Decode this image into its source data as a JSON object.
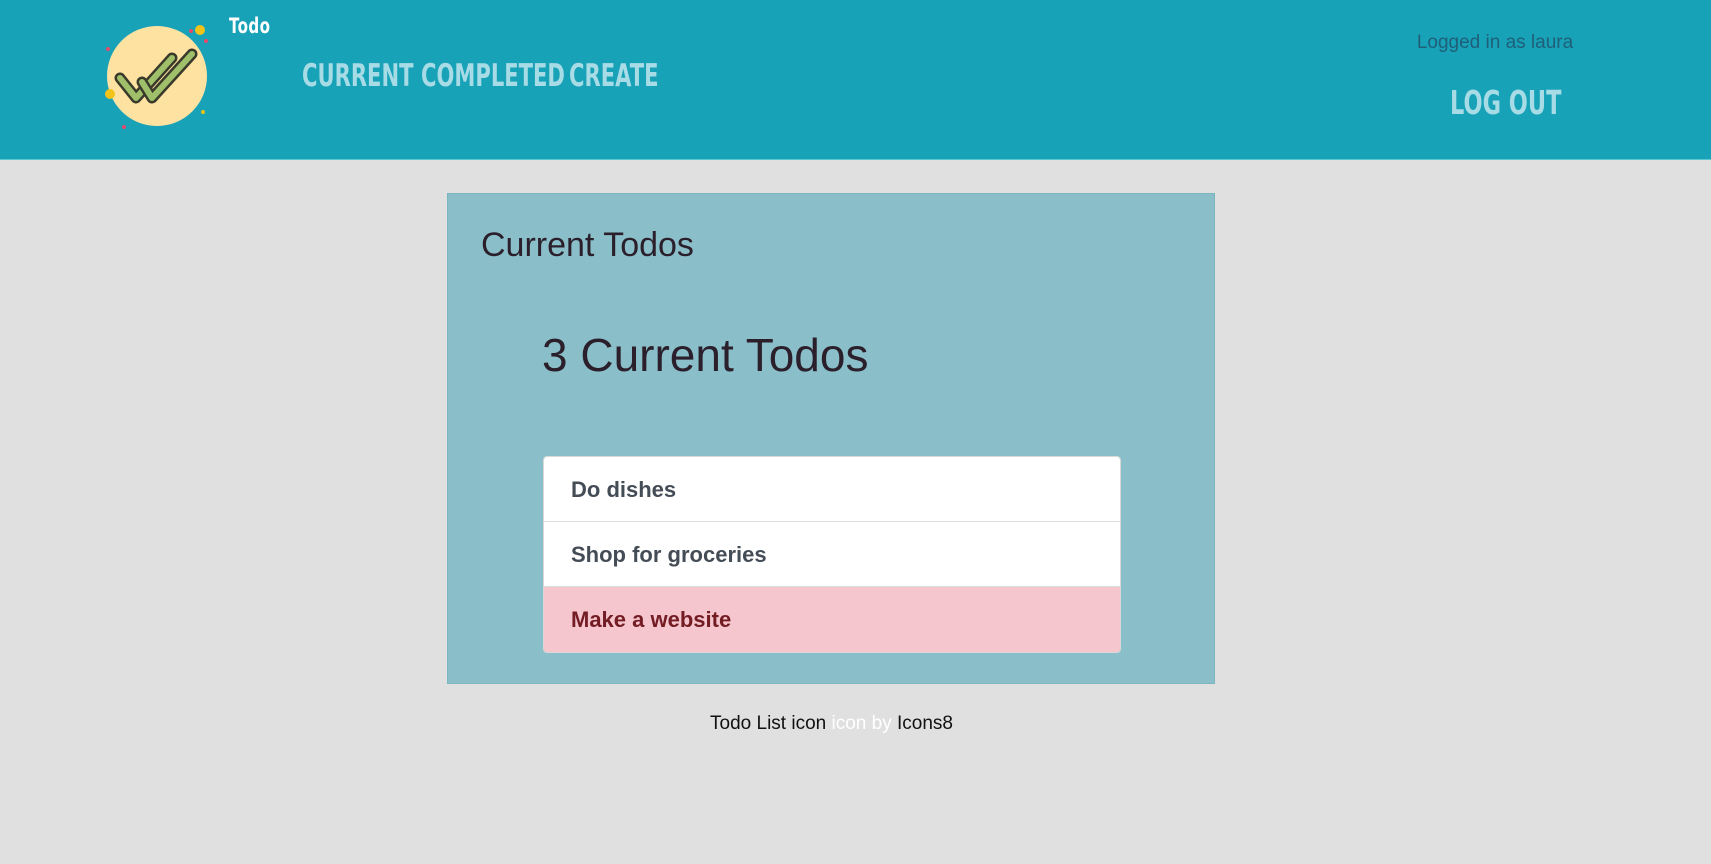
{
  "header": {
    "brand": "Todo",
    "logo_icon": "double-check-icon",
    "nav": [
      {
        "label": "Current"
      },
      {
        "label": "Completed"
      },
      {
        "label": "Create"
      }
    ],
    "logged_in_text": "Logged in as laura",
    "logout_label": "Log out"
  },
  "main": {
    "title": "Current Todos",
    "count_heading": "3 Current Todos",
    "todos": [
      {
        "label": "Do dishes",
        "style": "default"
      },
      {
        "label": "Shop for groceries",
        "style": "default"
      },
      {
        "label": "Make a website",
        "style": "danger"
      }
    ]
  },
  "footer": {
    "link1": "Todo List icon",
    "middle": "icon by",
    "link2": "Icons8"
  },
  "colors": {
    "header_bg": "#18a2b8",
    "card_bg": "#8abfc9",
    "page_bg": "#e0e0e0",
    "danger_bg": "#f5c6cd",
    "danger_text": "#731c24"
  }
}
